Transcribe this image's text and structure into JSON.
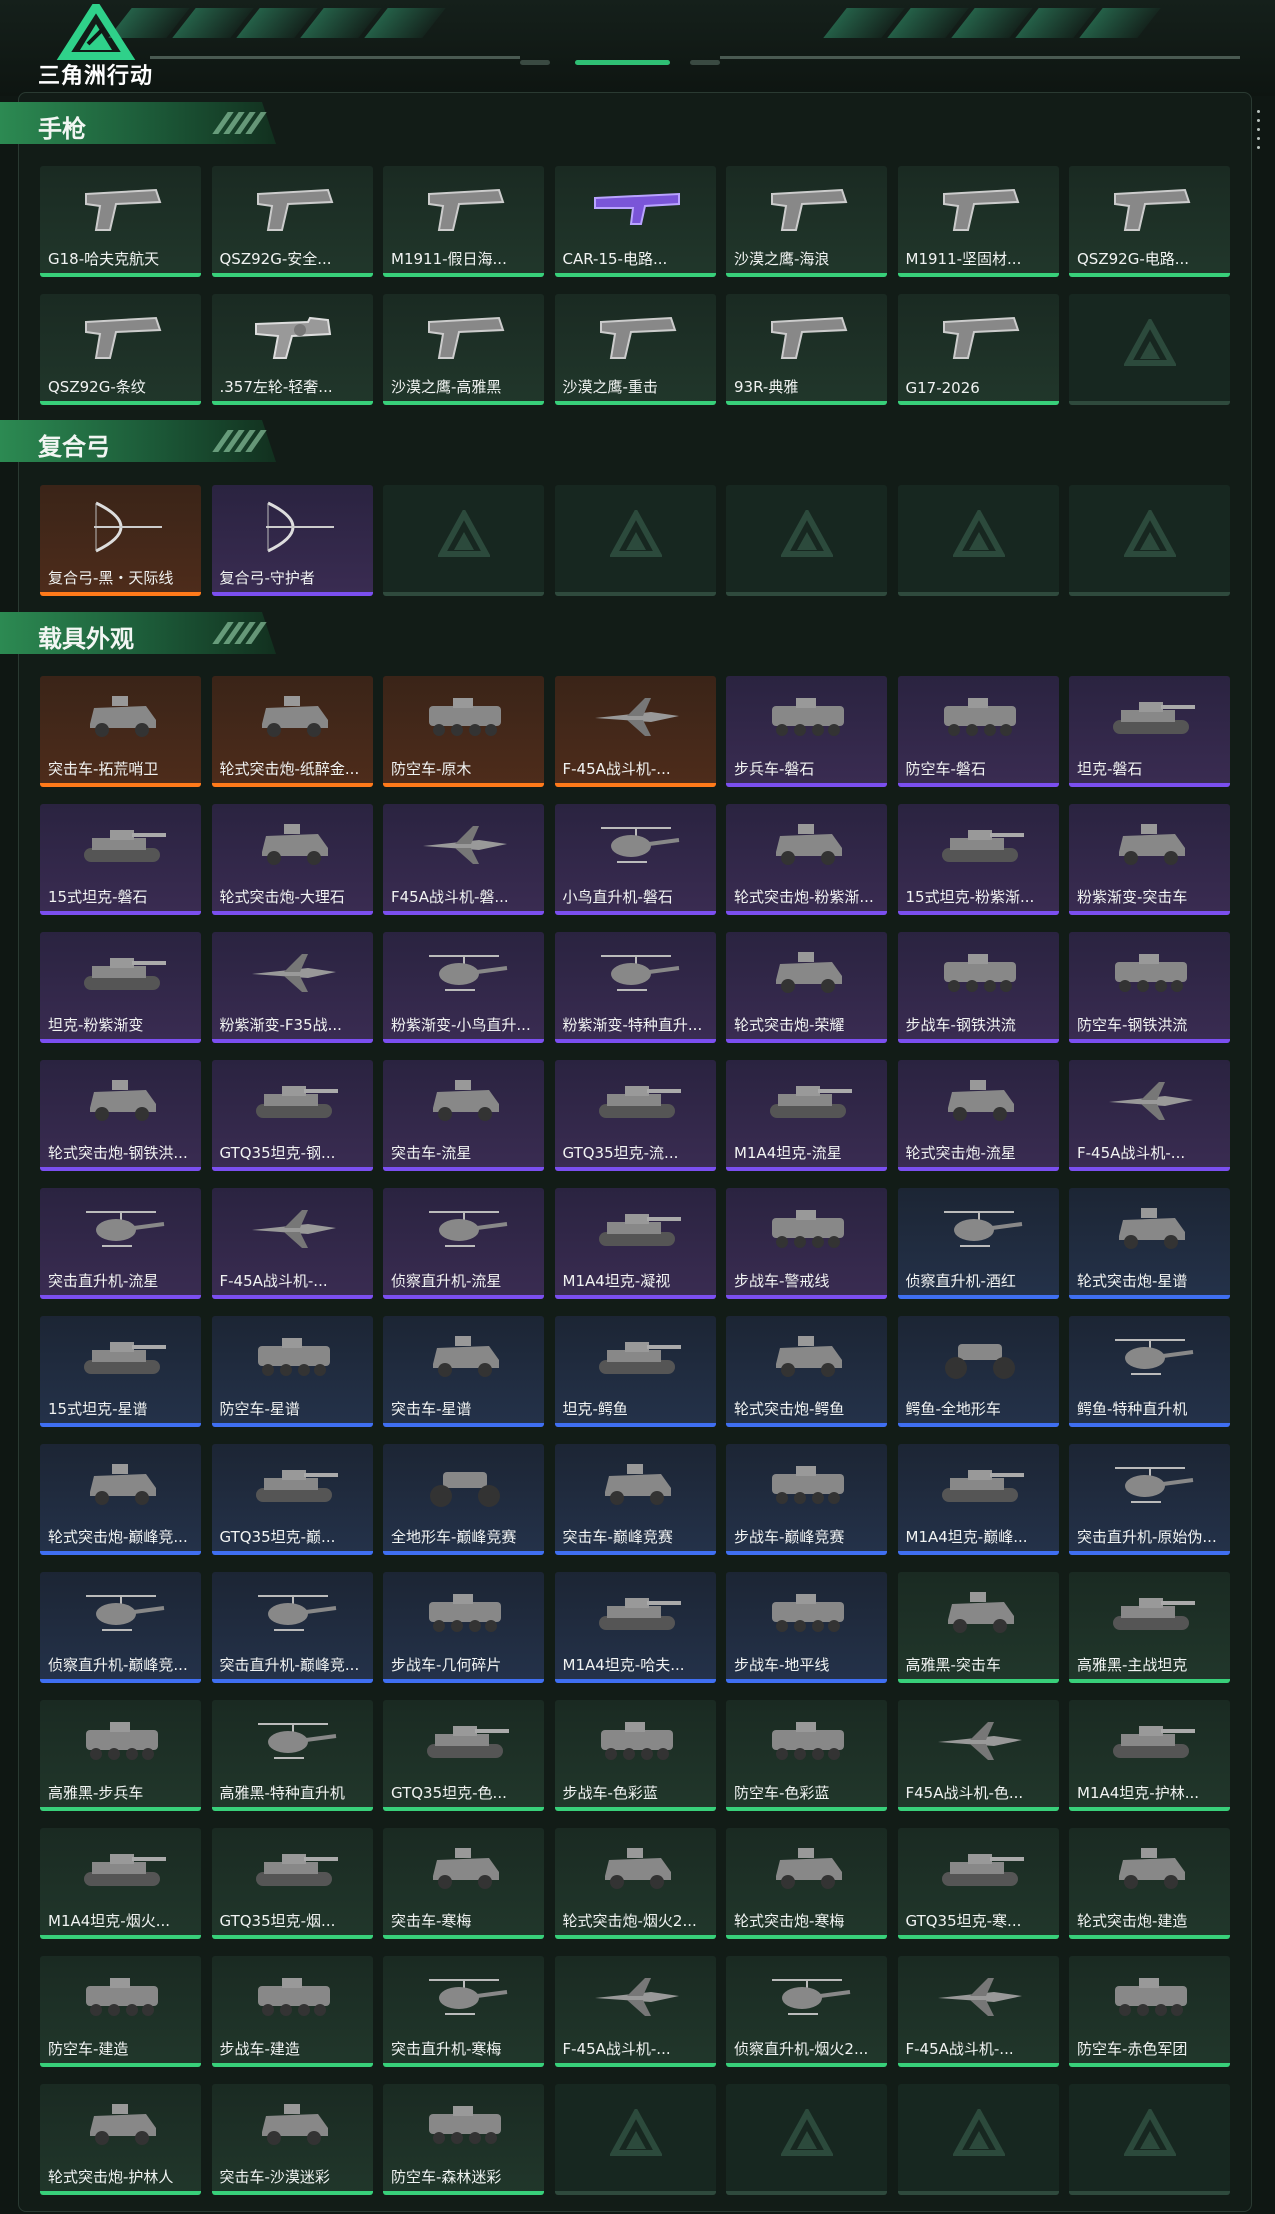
{
  "app": {
    "title": "三角洲行动"
  },
  "colors": {
    "accent": "#38d07a",
    "purple": "#7b4ff0",
    "orange": "#ff7a1a",
    "blue": "#3f6ff2",
    "green": "#38d07a"
  },
  "sections": [
    {
      "title": "手枪",
      "items": [
        {
          "name": "G18-哈夫克航天",
          "rarity": "green",
          "icon": "pistol-icon"
        },
        {
          "name": "QSZ92G-安全...",
          "rarity": "green",
          "icon": "pistol-icon"
        },
        {
          "name": "M1911-假日海...",
          "rarity": "green",
          "icon": "pistol-icon"
        },
        {
          "name": "CAR-15-电路...",
          "rarity": "green",
          "icon": "rifle-icon"
        },
        {
          "name": "沙漠之鹰-海浪",
          "rarity": "green",
          "icon": "pistol-icon"
        },
        {
          "name": "M1911-坚固材...",
          "rarity": "green",
          "icon": "pistol-icon"
        },
        {
          "name": "QSZ92G-电路...",
          "rarity": "green",
          "icon": "pistol-icon"
        },
        {
          "name": "QSZ92G-条纹",
          "rarity": "green",
          "icon": "pistol-icon"
        },
        {
          "name": ".357左轮-轻奢...",
          "rarity": "green",
          "icon": "revolver-icon"
        },
        {
          "name": "沙漠之鹰-高雅黑",
          "rarity": "green",
          "icon": "pistol-icon"
        },
        {
          "name": "沙漠之鹰-重击",
          "rarity": "green",
          "icon": "pistol-icon"
        },
        {
          "name": "93R-典雅",
          "rarity": "green",
          "icon": "pistol-icon"
        },
        {
          "name": "G17-2026",
          "rarity": "green",
          "icon": "pistol-icon"
        },
        {
          "name": "",
          "rarity": "empty",
          "icon": "placeholder-logo-icon"
        }
      ]
    },
    {
      "title": "复合弓",
      "items": [
        {
          "name": "复合弓-黑・天际线",
          "rarity": "orange",
          "icon": "bow-icon"
        },
        {
          "name": "复合弓-守护者",
          "rarity": "purple",
          "icon": "bow-icon"
        },
        {
          "name": "",
          "rarity": "empty",
          "icon": "placeholder-logo-icon"
        },
        {
          "name": "",
          "rarity": "empty",
          "icon": "placeholder-logo-icon"
        },
        {
          "name": "",
          "rarity": "empty",
          "icon": "placeholder-logo-icon"
        },
        {
          "name": "",
          "rarity": "empty",
          "icon": "placeholder-logo-icon"
        },
        {
          "name": "",
          "rarity": "empty",
          "icon": "placeholder-logo-icon"
        }
      ]
    },
    {
      "title": "载具外观",
      "items": [
        {
          "name": "突击车-拓荒哨卫",
          "rarity": "orange",
          "icon": "armored-car-icon"
        },
        {
          "name": "轮式突击炮-纸醉金...",
          "rarity": "orange",
          "icon": "armored-car-icon"
        },
        {
          "name": "防空车-原木",
          "rarity": "orange",
          "icon": "apc-icon"
        },
        {
          "name": "F-45A战斗机-...",
          "rarity": "orange",
          "icon": "jet-icon"
        },
        {
          "name": "步兵车-磐石",
          "rarity": "purple",
          "icon": "apc-icon"
        },
        {
          "name": "防空车-磐石",
          "rarity": "purple",
          "icon": "apc-icon"
        },
        {
          "name": "坦克-磐石",
          "rarity": "purple",
          "icon": "tank-icon"
        },
        {
          "name": "15式坦克-磐石",
          "rarity": "purple",
          "icon": "tank-icon"
        },
        {
          "name": "轮式突击炮-大理石",
          "rarity": "purple",
          "icon": "armored-car-icon"
        },
        {
          "name": "F45A战斗机-磐...",
          "rarity": "purple",
          "icon": "jet-icon"
        },
        {
          "name": "小鸟直升机-磐石",
          "rarity": "purple",
          "icon": "helicopter-icon"
        },
        {
          "name": "轮式突击炮-粉紫渐...",
          "rarity": "purple",
          "icon": "armored-car-icon"
        },
        {
          "name": "15式坦克-粉紫渐...",
          "rarity": "purple",
          "icon": "tank-icon"
        },
        {
          "name": "粉紫渐变-突击车",
          "rarity": "purple",
          "icon": "armored-car-icon"
        },
        {
          "name": "坦克-粉紫渐变",
          "rarity": "purple",
          "icon": "tank-icon"
        },
        {
          "name": "粉紫渐变-F35战...",
          "rarity": "purple",
          "icon": "jet-icon"
        },
        {
          "name": "粉紫渐变-小鸟直升...",
          "rarity": "purple",
          "icon": "helicopter-icon"
        },
        {
          "name": "粉紫渐变-特种直升...",
          "rarity": "purple",
          "icon": "helicopter-icon"
        },
        {
          "name": "轮式突击炮-荣耀",
          "rarity": "purple",
          "icon": "armored-car-icon"
        },
        {
          "name": "步战车-钢铁洪流",
          "rarity": "purple",
          "icon": "apc-icon"
        },
        {
          "name": "防空车-钢铁洪流",
          "rarity": "purple",
          "icon": "apc-icon"
        },
        {
          "name": "轮式突击炮-钢铁洪...",
          "rarity": "purple",
          "icon": "armored-car-icon"
        },
        {
          "name": "GTQ35坦克-钢...",
          "rarity": "purple",
          "icon": "tank-icon"
        },
        {
          "name": "突击车-流星",
          "rarity": "purple",
          "icon": "armored-car-icon"
        },
        {
          "name": "GTQ35坦克-流...",
          "rarity": "purple",
          "icon": "tank-icon"
        },
        {
          "name": "M1A4坦克-流星",
          "rarity": "purple",
          "icon": "tank-icon"
        },
        {
          "name": "轮式突击炮-流星",
          "rarity": "purple",
          "icon": "armored-car-icon"
        },
        {
          "name": "F-45A战斗机-...",
          "rarity": "purple",
          "icon": "jet-icon"
        },
        {
          "name": "突击直升机-流星",
          "rarity": "purple",
          "icon": "helicopter-icon"
        },
        {
          "name": "F-45A战斗机-...",
          "rarity": "purple",
          "icon": "jet-icon"
        },
        {
          "name": "侦察直升机-流星",
          "rarity": "purple",
          "icon": "helicopter-icon"
        },
        {
          "name": "M1A4坦克-凝视",
          "rarity": "purple",
          "icon": "tank-icon"
        },
        {
          "name": "步战车-警戒线",
          "rarity": "purple",
          "icon": "apc-icon"
        },
        {
          "name": "侦察直升机-酒红",
          "rarity": "blue",
          "icon": "helicopter-icon"
        },
        {
          "name": "轮式突击炮-星谱",
          "rarity": "blue",
          "icon": "armored-car-icon"
        },
        {
          "name": "15式坦克-星谱",
          "rarity": "blue",
          "icon": "tank-icon"
        },
        {
          "name": "防空车-星谱",
          "rarity": "blue",
          "icon": "apc-icon"
        },
        {
          "name": "突击车-星谱",
          "rarity": "blue",
          "icon": "armored-car-icon"
        },
        {
          "name": "坦克-鳄鱼",
          "rarity": "blue",
          "icon": "tank-icon"
        },
        {
          "name": "轮式突击炮-鳄鱼",
          "rarity": "blue",
          "icon": "armored-car-icon"
        },
        {
          "name": "鳄鱼-全地形车",
          "rarity": "blue",
          "icon": "atv-icon"
        },
        {
          "name": "鳄鱼-特种直升机",
          "rarity": "blue",
          "icon": "helicopter-icon"
        },
        {
          "name": "轮式突击炮-巅峰竞...",
          "rarity": "blue",
          "icon": "armored-car-icon"
        },
        {
          "name": "GTQ35坦克-巅...",
          "rarity": "blue",
          "icon": "tank-icon"
        },
        {
          "name": "全地形车-巅峰竞赛",
          "rarity": "blue",
          "icon": "atv-icon"
        },
        {
          "name": "突击车-巅峰竞赛",
          "rarity": "blue",
          "icon": "armored-car-icon"
        },
        {
          "name": "步战车-巅峰竞赛",
          "rarity": "blue",
          "icon": "apc-icon"
        },
        {
          "name": "M1A4坦克-巅峰...",
          "rarity": "blue",
          "icon": "tank-icon"
        },
        {
          "name": "突击直升机-原始伪...",
          "rarity": "blue",
          "icon": "helicopter-icon"
        },
        {
          "name": "侦察直升机-巅峰竞...",
          "rarity": "blue",
          "icon": "helicopter-icon"
        },
        {
          "name": "突击直升机-巅峰竞...",
          "rarity": "blue",
          "icon": "helicopter-icon"
        },
        {
          "name": "步战车-几何碎片",
          "rarity": "blue",
          "icon": "apc-icon"
        },
        {
          "name": "M1A4坦克-哈夫...",
          "rarity": "blue",
          "icon": "tank-icon"
        },
        {
          "name": "步战车-地平线",
          "rarity": "blue",
          "icon": "apc-icon"
        },
        {
          "name": "高雅黑-突击车",
          "rarity": "green",
          "icon": "armored-car-icon"
        },
        {
          "name": "高雅黑-主战坦克",
          "rarity": "green",
          "icon": "tank-icon"
        },
        {
          "name": "高雅黑-步兵车",
          "rarity": "green",
          "icon": "apc-icon"
        },
        {
          "name": "高雅黑-特种直升机",
          "rarity": "green",
          "icon": "helicopter-icon"
        },
        {
          "name": "GTQ35坦克-色...",
          "rarity": "green",
          "icon": "tank-icon"
        },
        {
          "name": "步战车-色彩蓝",
          "rarity": "green",
          "icon": "apc-icon"
        },
        {
          "name": "防空车-色彩蓝",
          "rarity": "green",
          "icon": "apc-icon"
        },
        {
          "name": "F45A战斗机-色...",
          "rarity": "green",
          "icon": "jet-icon"
        },
        {
          "name": "M1A4坦克-护林...",
          "rarity": "green",
          "icon": "tank-icon"
        },
        {
          "name": "M1A4坦克-烟火...",
          "rarity": "green",
          "icon": "tank-icon"
        },
        {
          "name": "GTQ35坦克-烟...",
          "rarity": "green",
          "icon": "tank-icon"
        },
        {
          "name": "突击车-寒梅",
          "rarity": "green",
          "icon": "armored-car-icon"
        },
        {
          "name": "轮式突击炮-烟火2...",
          "rarity": "green",
          "icon": "armored-car-icon"
        },
        {
          "name": "轮式突击炮-寒梅",
          "rarity": "green",
          "icon": "armored-car-icon"
        },
        {
          "name": "GTQ35坦克-寒...",
          "rarity": "green",
          "icon": "tank-icon"
        },
        {
          "name": "轮式突击炮-建造",
          "rarity": "green",
          "icon": "armored-car-icon"
        },
        {
          "name": "防空车-建造",
          "rarity": "green",
          "icon": "apc-icon"
        },
        {
          "name": "步战车-建造",
          "rarity": "green",
          "icon": "apc-icon"
        },
        {
          "name": "突击直升机-寒梅",
          "rarity": "green",
          "icon": "helicopter-icon"
        },
        {
          "name": "F-45A战斗机-...",
          "rarity": "green",
          "icon": "jet-icon"
        },
        {
          "name": "侦察直升机-烟火2...",
          "rarity": "green",
          "icon": "helicopter-icon"
        },
        {
          "name": "F-45A战斗机-...",
          "rarity": "green",
          "icon": "jet-icon"
        },
        {
          "name": "防空车-赤色军团",
          "rarity": "green",
          "icon": "apc-icon"
        },
        {
          "name": "轮式突击炮-护林人",
          "rarity": "green",
          "icon": "armored-car-icon"
        },
        {
          "name": "突击车-沙漠迷彩",
          "rarity": "green",
          "icon": "armored-car-icon"
        },
        {
          "name": "防空车-森林迷彩",
          "rarity": "green",
          "icon": "apc-icon"
        },
        {
          "name": "",
          "rarity": "empty",
          "icon": "placeholder-logo-icon"
        },
        {
          "name": "",
          "rarity": "empty",
          "icon": "placeholder-logo-icon"
        },
        {
          "name": "",
          "rarity": "empty",
          "icon": "placeholder-logo-icon"
        },
        {
          "name": "",
          "rarity": "empty",
          "icon": "placeholder-logo-icon"
        }
      ]
    }
  ]
}
